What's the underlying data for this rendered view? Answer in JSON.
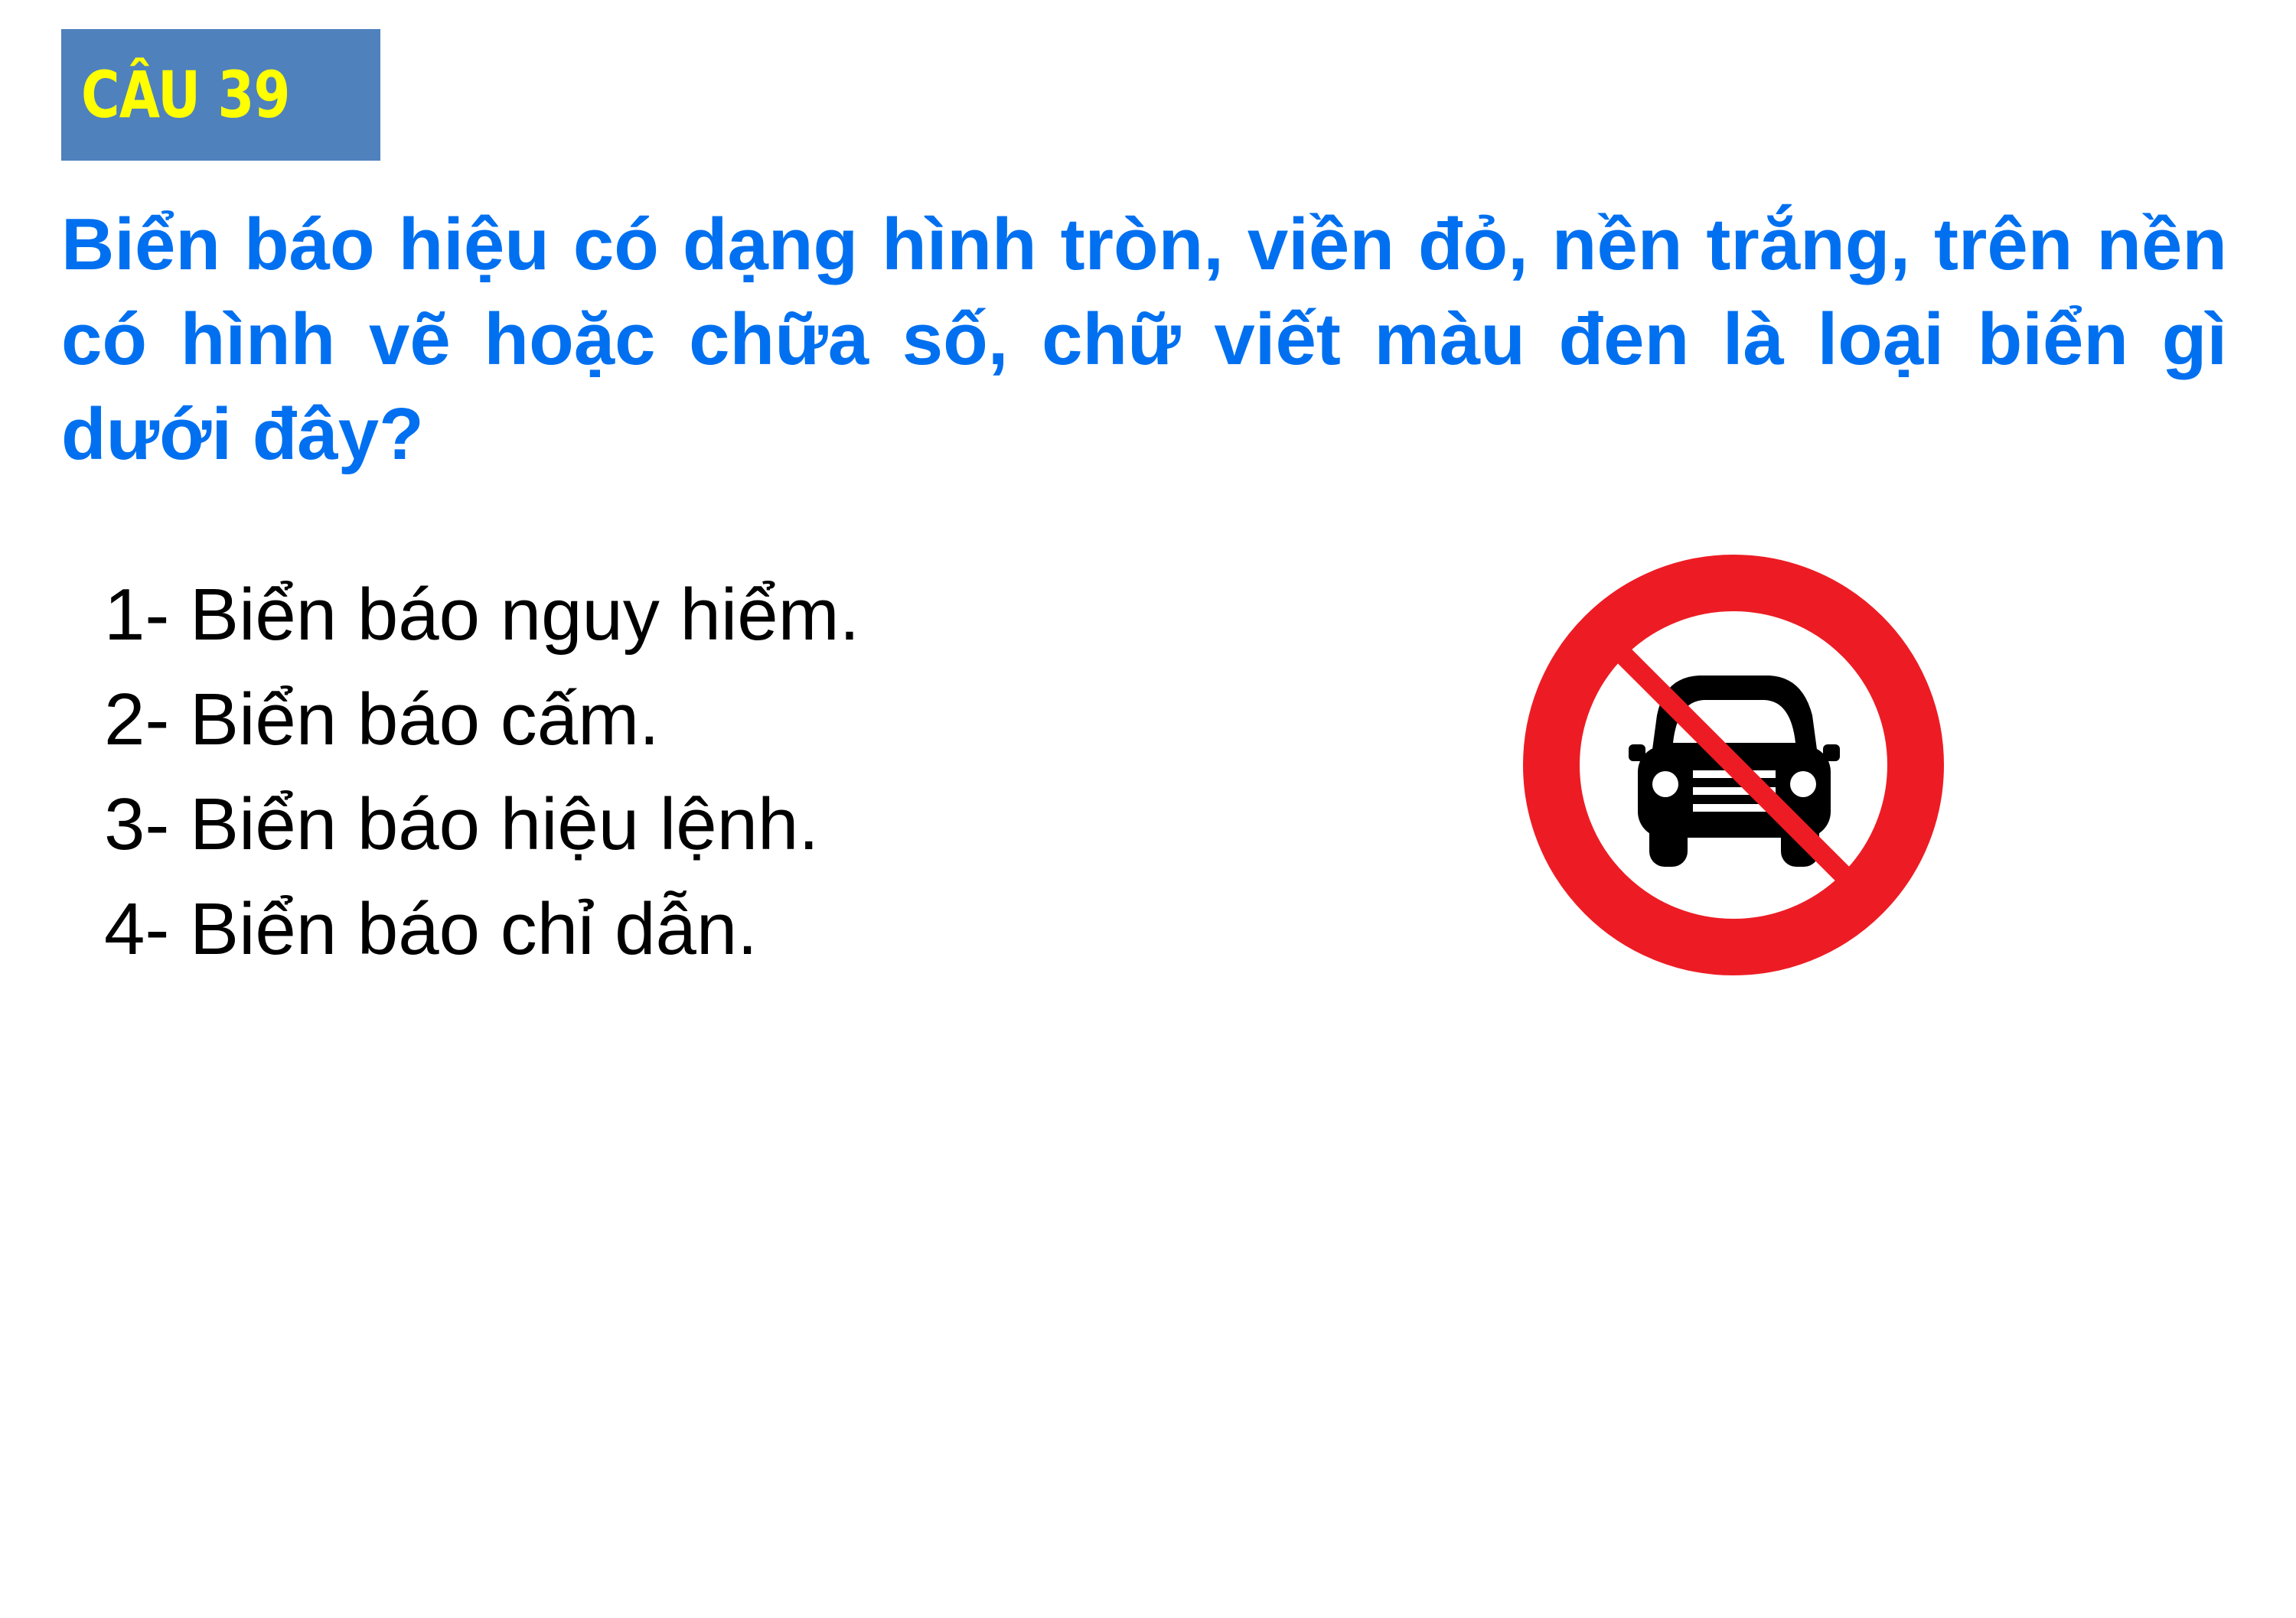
{
  "header": {
    "badge_label": "CÂU 39",
    "badge_color": "#4f81bd",
    "badge_text_color": "#ffff00"
  },
  "question": {
    "text": "Biển báo hiệu có dạng hình tròn, viền đỏ, nền trắng, trên nền có hình vẽ hoặc chữa số, chữ viết màu đen là loại biển gì dưới đây?",
    "color": "#0070f0"
  },
  "answers": [
    "1- Biển báo nguy hiểm.",
    "2- Biển báo cấm.",
    "3- Biển báo hiệu lệnh.",
    "4- Biển báo chỉ dẫn."
  ],
  "sign": {
    "icon": "no-cars-sign-icon",
    "ring_color": "#ed1c24",
    "symbol_color": "#000000"
  }
}
